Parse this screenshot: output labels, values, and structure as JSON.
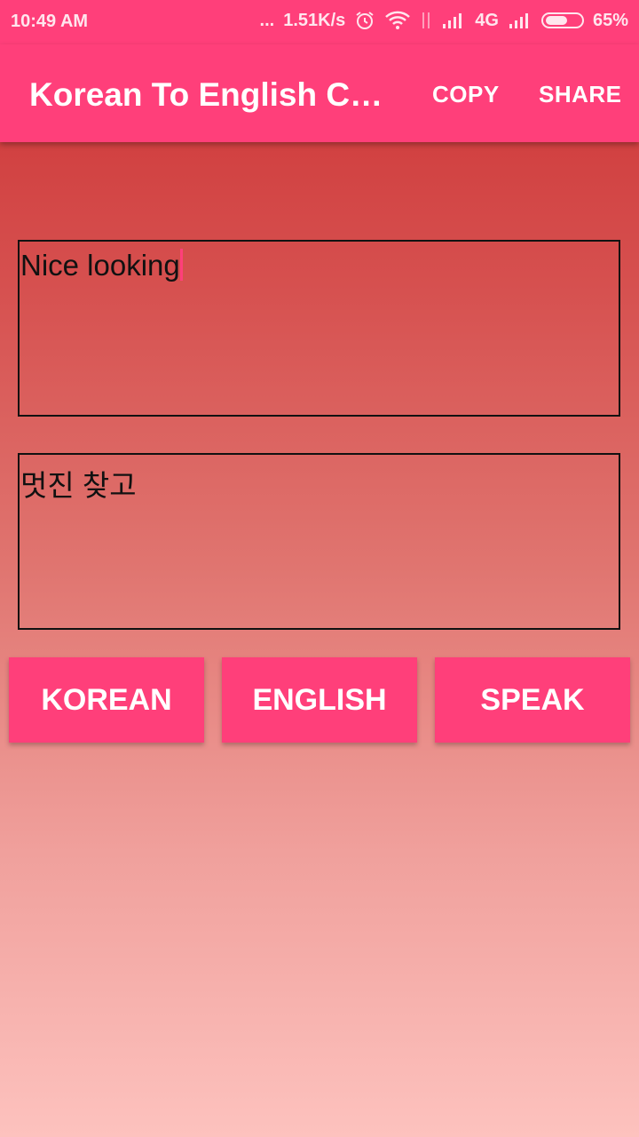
{
  "status_bar": {
    "time": "10:49 AM",
    "dots": "...",
    "net_speed": "1.51K/s",
    "network": "4G",
    "battery": "65%",
    "battery_level": 0.65,
    "icons": [
      "alarm-icon",
      "wifi-icon",
      "data-transfer-icon",
      "signal-icon",
      "signal-icon",
      "battery-icon"
    ]
  },
  "app_bar": {
    "title": "Korean To English Converter",
    "actions": {
      "copy": "COPY",
      "share": "SHARE"
    }
  },
  "colors": {
    "accent": "#ff3f7a",
    "bg_top": "#cc3233",
    "bg_bottom": "#fdc2be"
  },
  "input": {
    "value": "Nice looking"
  },
  "output": {
    "value": "멋진 찾고"
  },
  "buttons": {
    "korean": "KOREAN",
    "english": "ENGLISH",
    "speak": "SPEAK"
  }
}
